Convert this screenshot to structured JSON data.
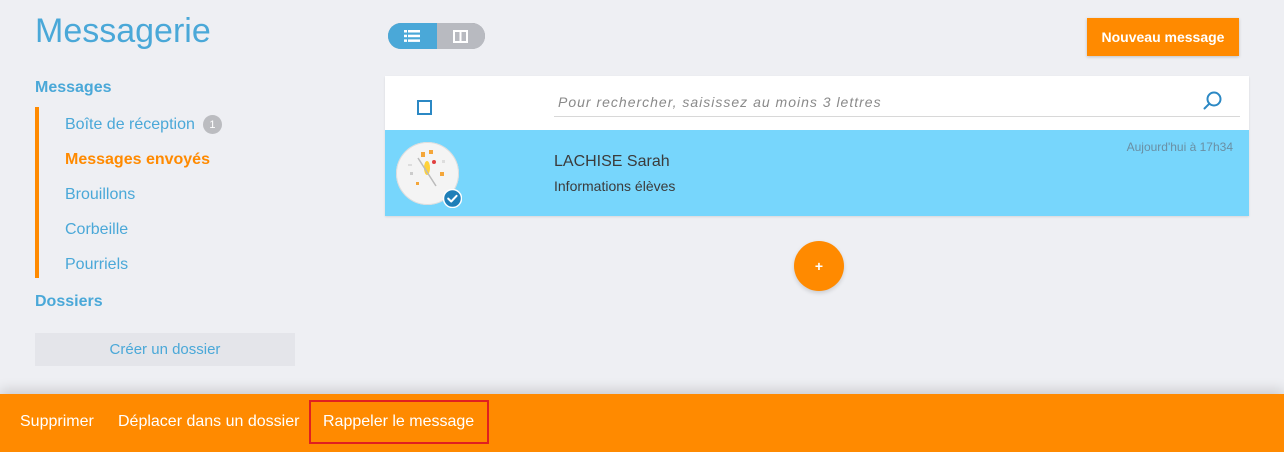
{
  "header": {
    "title": "Messagerie",
    "new_message_label": "Nouveau message"
  },
  "sidebar": {
    "messages_heading": "Messages",
    "items": [
      {
        "label": "Boîte de réception",
        "badge": "1",
        "active": false
      },
      {
        "label": "Messages envoyés",
        "active": true
      },
      {
        "label": "Brouillons",
        "active": false
      },
      {
        "label": "Corbeille",
        "active": false
      },
      {
        "label": "Pourriels",
        "active": false
      }
    ],
    "folders_heading": "Dossiers",
    "create_folder_label": "Créer un dossier"
  },
  "view_toggle": {
    "options": [
      "list-icon",
      "split-view-icon"
    ],
    "selected": "list-icon"
  },
  "search": {
    "placeholder": "Pour rechercher, saisissez au moins 3 lettres"
  },
  "messages": [
    {
      "sender": "LACHISE Sarah",
      "subject": "Informations élèves",
      "date": "Aujourd'hui à 17h34",
      "selected": true
    }
  ],
  "fab_label": "+",
  "action_bar": {
    "delete_label": "Supprimer",
    "move_label": "Déplacer dans un dossier",
    "recall_label": "Rappeler le message"
  },
  "colors": {
    "accent": "#ff8a00",
    "primary": "#4aa8d8",
    "selected_row": "#77d6fc",
    "background": "#eeeff3"
  }
}
